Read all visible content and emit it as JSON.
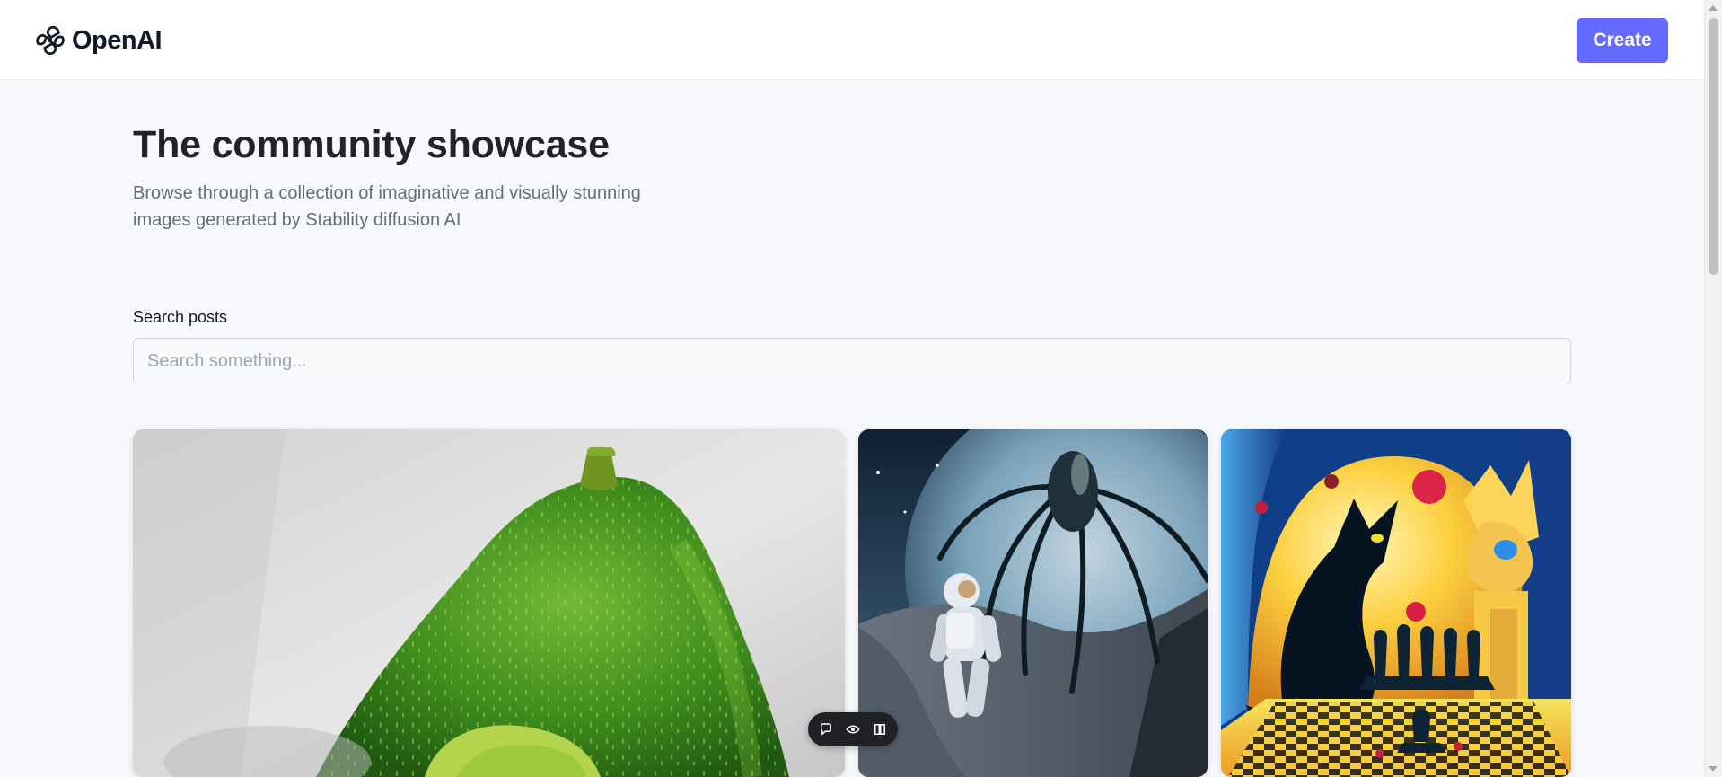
{
  "header": {
    "brand": "OpenAI",
    "brand_icon": "openai-logo-icon",
    "create_label": "Create",
    "create_color": "#6469ff"
  },
  "hero": {
    "title": "The community showcase",
    "description": "Browse through a collection of imaginative and visually stunning images generated by Stability diffusion AI"
  },
  "search": {
    "label": "Search posts",
    "placeholder": "Search something...",
    "value": ""
  },
  "gallery": {
    "items": [
      {
        "subject": "avocado-image",
        "icon": "image-icon"
      },
      {
        "subject": "astronaut-alien-image",
        "icon": "image-icon"
      },
      {
        "subject": "surreal-cat-chess-image",
        "icon": "image-icon"
      }
    ]
  },
  "floating_toolbar": {
    "icons": [
      "comment-icon",
      "eye-icon",
      "book-icon"
    ]
  },
  "colors": {
    "background": "#f7f8fc",
    "header": "#ffffff",
    "title": "#222328",
    "muted_text": "#666e75",
    "accent": "#6469ff"
  }
}
